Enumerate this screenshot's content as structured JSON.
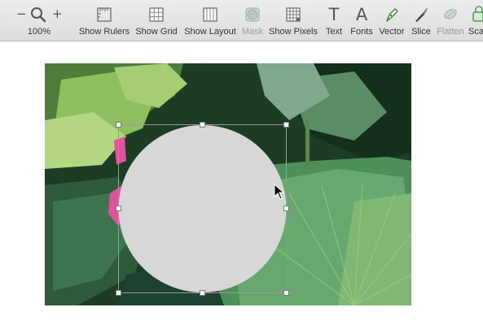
{
  "toolbar": {
    "zoom": {
      "value": "100%",
      "minus_symbol": "−",
      "plus_symbol": "+"
    },
    "tools": {
      "rulers": {
        "label": "Show Rulers",
        "icon": "ruler-icon"
      },
      "grid": {
        "label": "Show Grid",
        "icon": "grid-icon"
      },
      "layout": {
        "label": "Show Layout",
        "icon": "layout-columns-icon"
      },
      "mask": {
        "label": "Mask",
        "icon": "mask-icon",
        "enabled": false
      },
      "pixels": {
        "label": "Show Pixels",
        "icon": "pixel-grid-icon"
      },
      "text": {
        "label": "Text",
        "icon": "text-tool-icon",
        "glyph": "T"
      },
      "fonts": {
        "label": "Fonts",
        "icon": "fonts-icon",
        "glyph": "A"
      },
      "vector": {
        "label": "Vector",
        "icon": "pen-icon"
      },
      "slice": {
        "label": "Slice",
        "icon": "knife-icon"
      },
      "flatten": {
        "label": "Flatten",
        "icon": "flatten-icon",
        "enabled": false
      },
      "scale": {
        "label": "Sca",
        "icon": "scale-icon"
      }
    }
  },
  "canvas": {
    "artboard_image": "lotus-leaves-photo",
    "selected_shape": {
      "type": "circle",
      "fill": "#d7d7d7",
      "selected": true
    },
    "colors": {
      "leaf_dark": "#1f4a2a",
      "leaf_light": "#8fc46a",
      "flower_pink": "#e0529c"
    }
  }
}
